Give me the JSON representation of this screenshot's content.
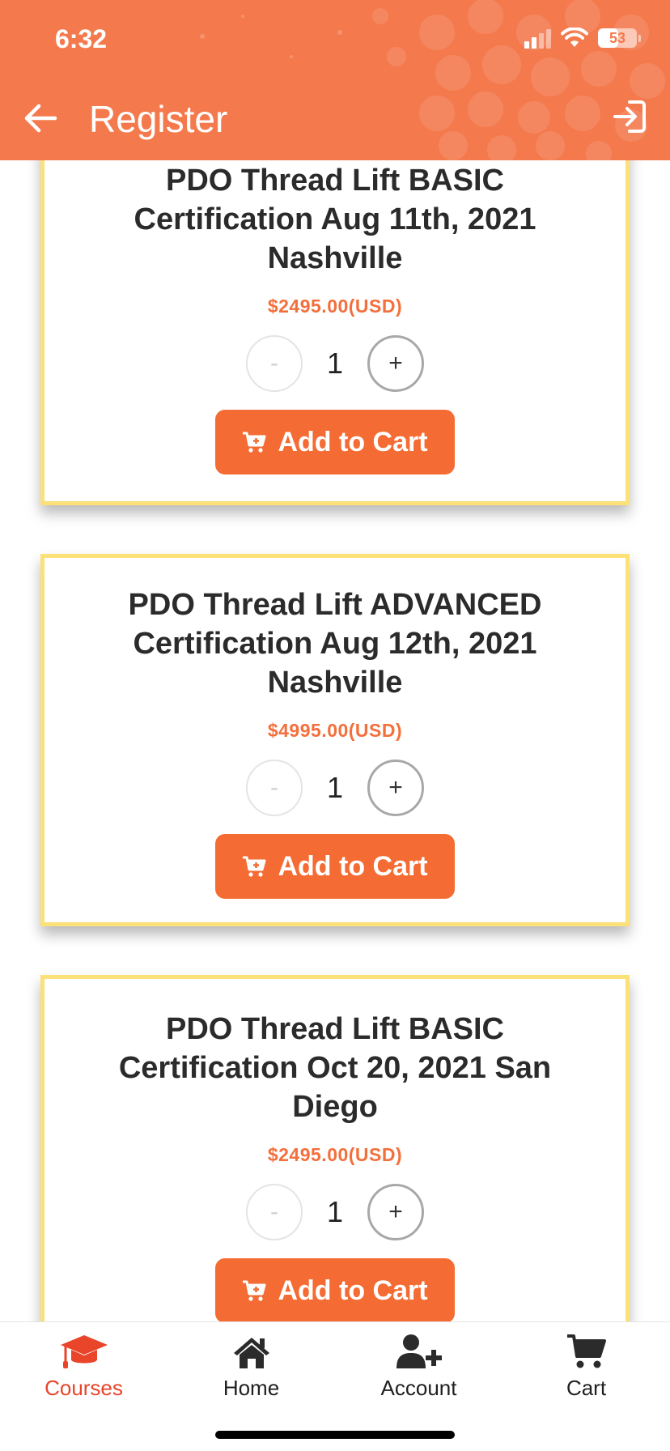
{
  "status_bar": {
    "time": "6:32",
    "battery": "53",
    "battery_level": 0.53
  },
  "header": {
    "title": "Register",
    "background_color": "#f47a4e"
  },
  "courses": [
    {
      "title": "PDO Thread Lift BASIC Certification Aug 11th, 2021 Nashville",
      "price": "$2495.00(USD)",
      "minus_label": "-",
      "quantity": "1",
      "plus_label": "+",
      "add_label": "Add to Cart"
    },
    {
      "title": "PDO Thread Lift ADVANCED Certification Aug 12th, 2021 Nashville",
      "price": "$4995.00(USD)",
      "minus_label": "-",
      "quantity": "1",
      "plus_label": "+",
      "add_label": "Add to Cart"
    },
    {
      "title": "PDO Thread Lift BASIC Certification Oct 20, 2021 San Diego",
      "price": "$2495.00(USD)",
      "minus_label": "-",
      "quantity": "1",
      "plus_label": "+",
      "add_label": "Add to Cart"
    }
  ],
  "colors": {
    "accent": "#f46b33",
    "card_border": "#fbe177",
    "price": "#f36f3c",
    "active_tab": "#e8452a"
  },
  "tabbar": {
    "tabs": [
      {
        "label": "Courses",
        "icon": "graduation-cap-icon",
        "active": true
      },
      {
        "label": "Home",
        "icon": "home-icon",
        "active": false
      },
      {
        "label": "Account",
        "icon": "add-user-icon",
        "active": false
      },
      {
        "label": "Cart",
        "icon": "cart-icon",
        "active": false
      }
    ]
  }
}
